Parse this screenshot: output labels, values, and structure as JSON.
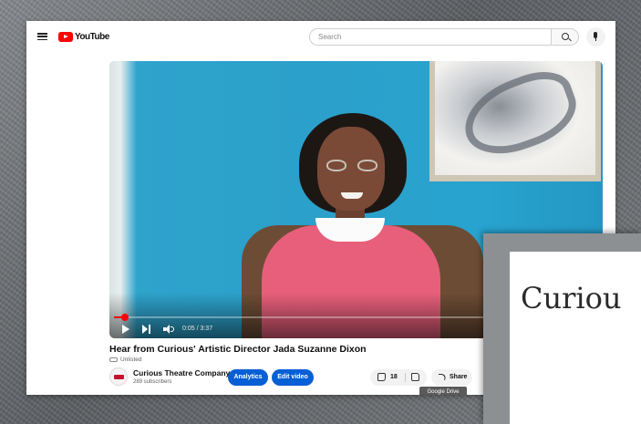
{
  "header": {
    "logo_text": "YouTube",
    "search_placeholder": "Search",
    "icons": [
      "menu-icon",
      "search-icon",
      "mic-icon"
    ]
  },
  "player": {
    "time": "0:05 / 3:37",
    "progress_fraction": 0.023
  },
  "video": {
    "title": "Hear from Curious' Artistic Director Jada Suzanne Dixon",
    "visibility": "Unlisted"
  },
  "channel": {
    "name": "Curious Theatre Company",
    "subscribers": "289 subscribers"
  },
  "actions": {
    "analytics_label": "Analytics",
    "edit_label": "Edit video",
    "like_count": "18",
    "share_label": "Share",
    "tooltip": "Google Drive"
  },
  "overlay": {
    "text": "Curiou"
  },
  "colors": {
    "brand_red": "#ff0000",
    "button_blue": "#065fd4",
    "wall_blue": "#2ba0ca",
    "shirt_pink": "#e85f7b"
  }
}
